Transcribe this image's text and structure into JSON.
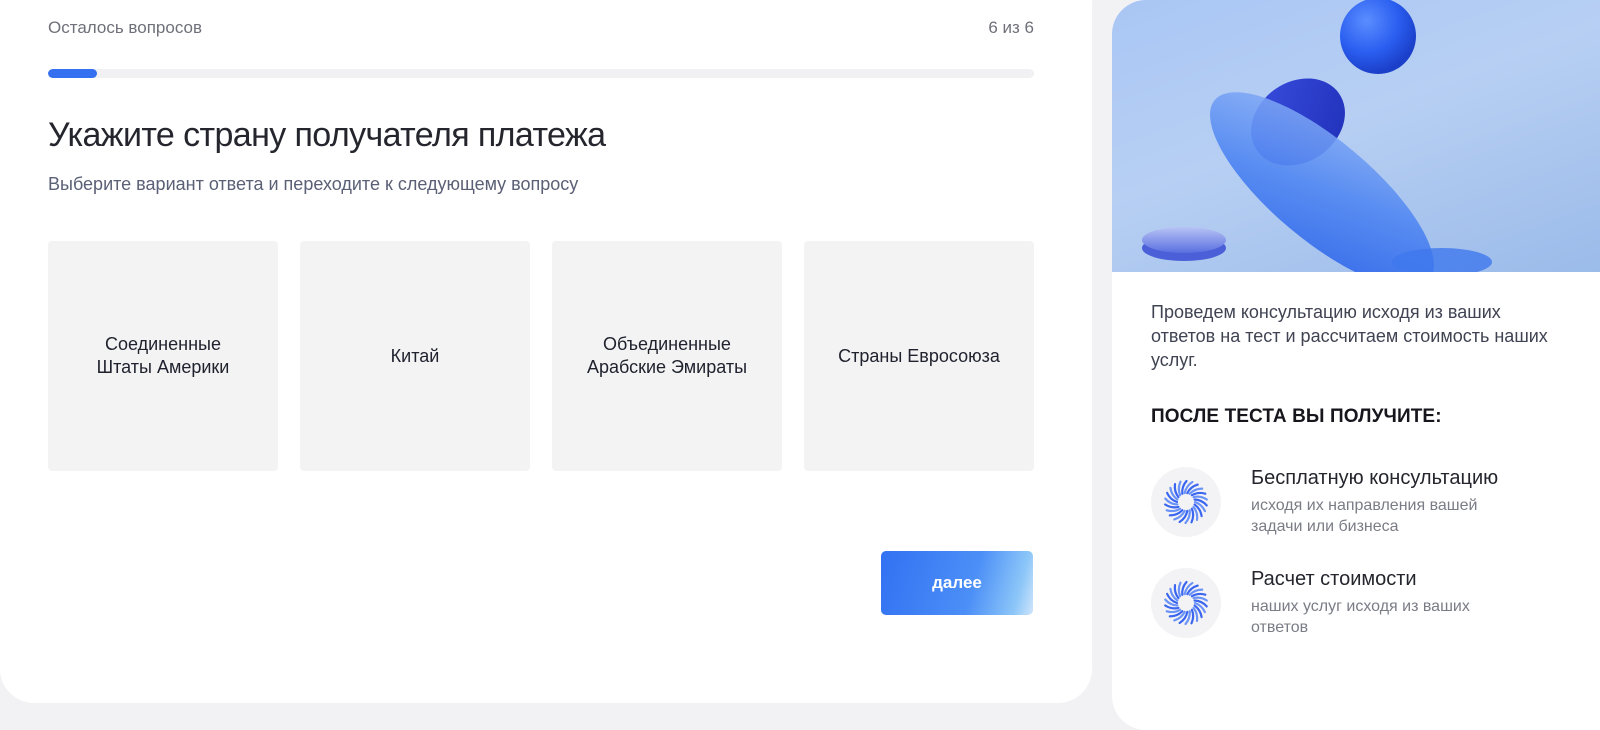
{
  "progress": {
    "label": "Осталось вопросов",
    "counter": "6 из 6",
    "fill_fraction": 0.05
  },
  "question": {
    "title": "Укажите страну получателя платежа",
    "subtitle": "Выберите вариант ответа и переходите к следующему вопросу"
  },
  "options": [
    {
      "label": "Соединенные\nШтаты Америки"
    },
    {
      "label": "Китай"
    },
    {
      "label": "Объединенные\nАрабские Эмираты"
    },
    {
      "label": "Страны Евросоюза"
    }
  ],
  "next_button": {
    "label": "далее"
  },
  "side": {
    "text": "Проведем консультацию исходя из ваших ответов на тест и рассчитаем стоимость наших услуг.",
    "benefits_title": "ПОСЛЕ ТЕСТА ВЫ ПОЛУЧИТЕ:",
    "benefits": [
      {
        "title": "Бесплатную консультацию",
        "desc": "исходя их направления вашей задачи или бизнеса",
        "icon": "spiral-burst-icon"
      },
      {
        "title": "Расчет стоимости",
        "desc": "наших услуг исходя из ваших ответов",
        "icon": "spiral-burst-icon"
      }
    ]
  },
  "colors": {
    "accent": "#3470f0",
    "card_bg": "#ffffff",
    "page_bg": "#f2f2f4",
    "option_bg": "#f3f3f4"
  }
}
